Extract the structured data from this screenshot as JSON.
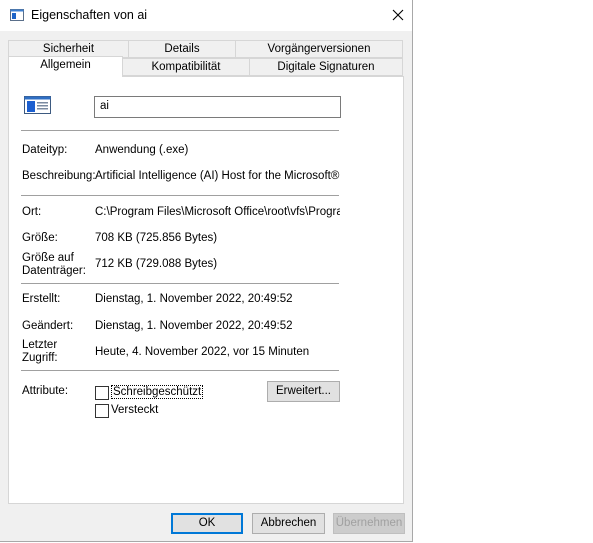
{
  "window": {
    "title": "Eigenschaften von ai",
    "close_glyph": "✕"
  },
  "tabs_row1": [
    {
      "label": "Sicherheit"
    },
    {
      "label": "Details"
    },
    {
      "label": "Vorgängerversionen"
    }
  ],
  "tabs_row2": [
    {
      "label": "Allgemein",
      "active": true
    },
    {
      "label": "Kompatibilität"
    },
    {
      "label": "Digitale Signaturen"
    }
  ],
  "general": {
    "name_value": "ai",
    "filetype_label": "Dateityp:",
    "filetype_value": "Anwendung (.exe)",
    "description_label": "Beschreibung:",
    "description_value": "Artificial Intelligence (AI) Host for the Microsoft® Win",
    "location_label": "Ort:",
    "location_value": "C:\\Program Files\\Microsoft Office\\root\\vfs\\ProgramF",
    "size_label": "Größe:",
    "size_value": "708 KB (725.856 Bytes)",
    "disk_size_label_1": "Größe auf",
    "disk_size_label_2": "Datenträger:",
    "disk_size_value": "712 KB (729.088 Bytes)",
    "created_label": "Erstellt:",
    "created_value": "Dienstag, 1. November 2022, 20:49:52",
    "modified_label": "Geändert:",
    "modified_value": "Dienstag, 1. November 2022, 20:49:52",
    "accessed_label_1": "Letzter",
    "accessed_label_2": "Zugriff:",
    "accessed_value": "Heute, 4. November 2022, vor 15 Minuten",
    "attributes_label": "Attribute:",
    "readonly_label": "Schreibgeschützt",
    "readonly_checked": false,
    "hidden_label": "Versteckt",
    "hidden_checked": false,
    "advanced_button": "Erweitert..."
  },
  "buttons": {
    "ok": "OK",
    "cancel": "Abbrechen",
    "apply": "Übernehmen"
  }
}
